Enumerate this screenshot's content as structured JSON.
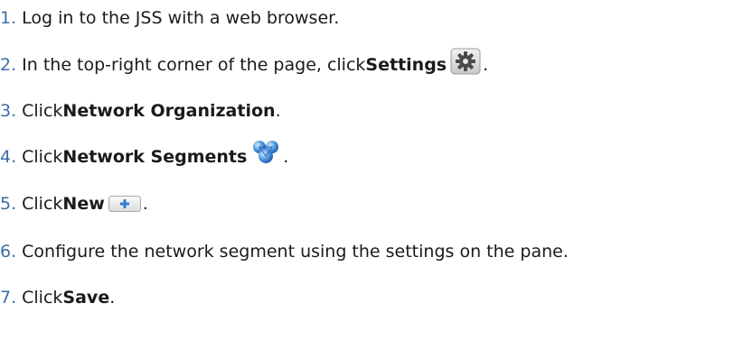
{
  "steps": [
    {
      "number": "1.",
      "text": "Log in to the JSS with a web browser."
    },
    {
      "number": "2.",
      "pre": "In the top-right corner of the page, click ",
      "bold": "Settings",
      "icon": "gear-icon",
      "post": "."
    },
    {
      "number": "3.",
      "pre": "Click ",
      "bold": "Network Organization",
      "post": "."
    },
    {
      "number": "4.",
      "pre": "Click ",
      "bold": "Network Segments",
      "icon": "globe-network-icon",
      "post": "."
    },
    {
      "number": "5.",
      "pre": "Click ",
      "bold": "New",
      "icon": "plus-icon",
      "post": "."
    },
    {
      "number": "6.",
      "text": "Configure the network segment using the settings on the pane."
    },
    {
      "number": "7.",
      "pre": "Click ",
      "bold": "Save",
      "post": "."
    }
  ],
  "colors": {
    "step_number": "#3c6fa6",
    "text": "#1a1a1a"
  }
}
